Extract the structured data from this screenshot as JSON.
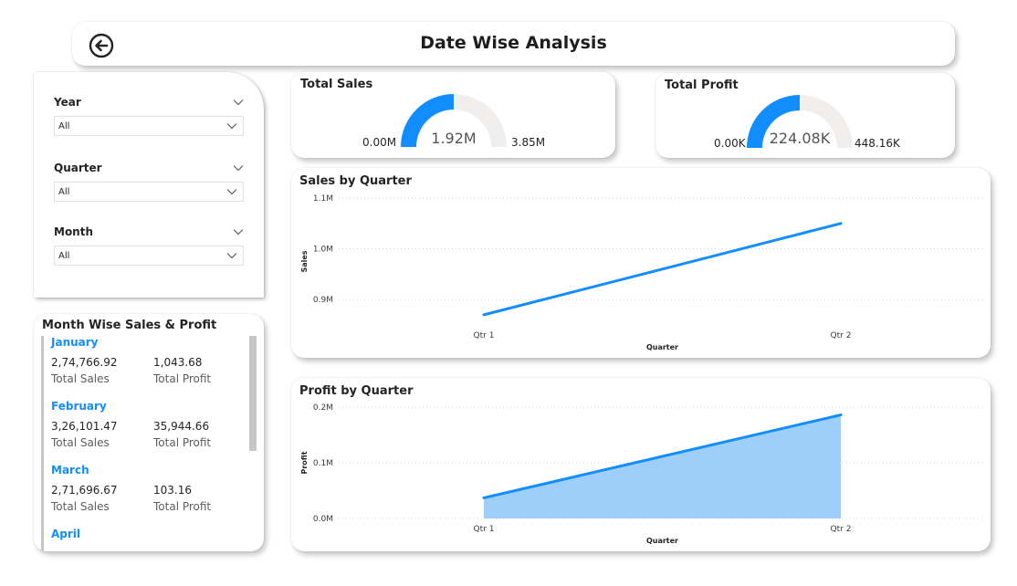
{
  "header": {
    "title": "Date Wise Analysis",
    "back_icon": "back-arrow-circle-icon"
  },
  "slicers": [
    {
      "label": "Year",
      "value": "All"
    },
    {
      "label": "Quarter",
      "value": "All"
    },
    {
      "label": "Month",
      "value": "All"
    }
  ],
  "kpis": {
    "sales": {
      "title": "Total Sales",
      "min": "0.00M",
      "value": "1.92M",
      "max": "3.85M",
      "fraction": 0.5
    },
    "profit": {
      "title": "Total Profit",
      "min": "0.00K",
      "value": "224.08K",
      "max": "448.16K",
      "fraction": 0.5
    }
  },
  "colors": {
    "accent": "#118dff",
    "area_fill": "#9ecffa",
    "gauge_track": "#f0efee",
    "month_name": "#118dff"
  },
  "month_list": {
    "title": "Month Wise Sales & Profit",
    "sales_label": "Total Sales",
    "profit_label": "Total Profit",
    "items": [
      {
        "month": "January",
        "sales": "2,74,766.92",
        "profit": "1,043.68"
      },
      {
        "month": "February",
        "sales": "3,26,101.47",
        "profit": "35,944.66"
      },
      {
        "month": "March",
        "sales": "2,71,696.67",
        "profit": "103.16"
      },
      {
        "month": "April",
        "sales": "",
        "profit": ""
      }
    ]
  },
  "chart_data": [
    {
      "type": "line",
      "title": "Sales by Quarter",
      "xlabel": "Quarter",
      "ylabel": "Sales",
      "categories": [
        "Qtr 1",
        "Qtr 2"
      ],
      "values": [
        870000,
        1050000
      ],
      "ylim": [
        0.85,
        1.1
      ],
      "yticks": [
        {
          "v": 0.9,
          "label": "0.9M"
        },
        {
          "v": 1.0,
          "label": "1.0M"
        },
        {
          "v": 1.1,
          "label": "1.1M"
        }
      ],
      "grid": true
    },
    {
      "type": "area",
      "title": "Profit by Quarter",
      "xlabel": "Quarter",
      "ylabel": "Profit",
      "categories": [
        "Qtr 1",
        "Qtr 2"
      ],
      "values": [
        37000,
        186000
      ],
      "ylim": [
        0,
        0.2
      ],
      "yticks": [
        {
          "v": 0.0,
          "label": "0.0M"
        },
        {
          "v": 0.1,
          "label": "0.1M"
        },
        {
          "v": 0.2,
          "label": "0.2M"
        }
      ],
      "grid": true
    }
  ]
}
